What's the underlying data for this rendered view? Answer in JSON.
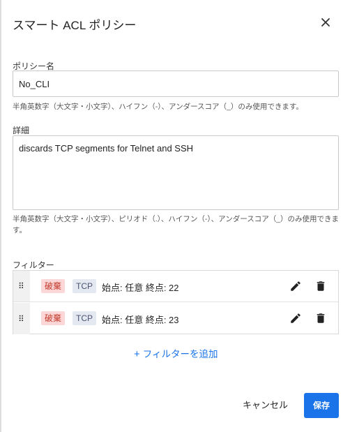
{
  "dialog": {
    "title": "スマート ACL ポリシー",
    "close_icon": "close-icon"
  },
  "policy_name": {
    "label": "ポリシー名",
    "value": "No_CLI",
    "hint": "半角英数字（大文字・小文字）、ハイフン（-）、アンダースコア（_）のみ使用できます。"
  },
  "description": {
    "label": "詳細",
    "value": "discards TCP segments for Telnet and SSH",
    "hint": "半角英数字（大文字・小文字）、ピリオド（.）、ハイフン（-）、アンダースコア（_）のみ使用できます。"
  },
  "filters": {
    "label": "フィルター",
    "items": [
      {
        "action": "破棄",
        "protocol": "TCP",
        "rule": "始点: 任意 終点: 22"
      },
      {
        "action": "破棄",
        "protocol": "TCP",
        "rule": "始点: 任意 終点: 23"
      }
    ],
    "add_label": "フィルターを追加"
  },
  "footer": {
    "cancel_label": "キャンセル",
    "save_label": "保存"
  },
  "colors": {
    "accent": "#1a73e8",
    "action_badge_bg": "#fcd7d7",
    "action_badge_text": "#c0392b",
    "protocol_badge_bg": "#e4e8f1"
  }
}
